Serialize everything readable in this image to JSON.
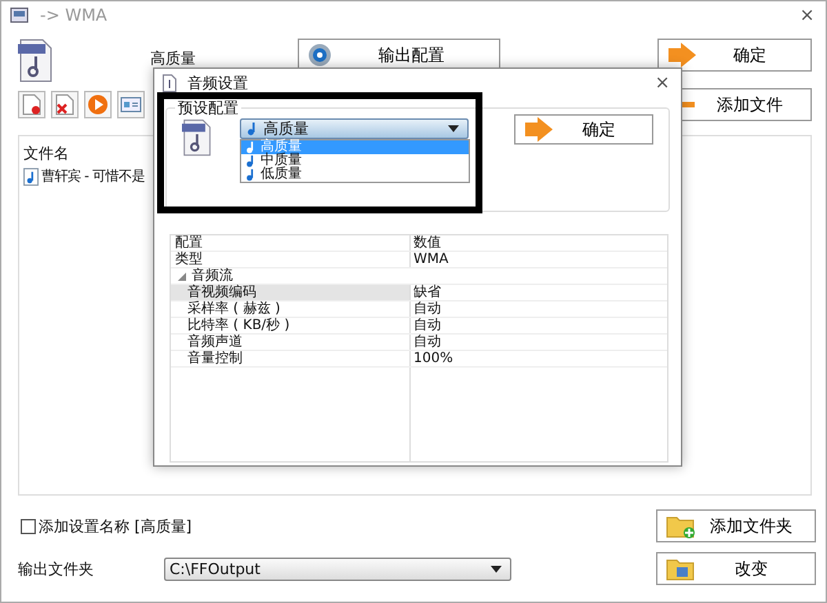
{
  "window": {
    "title": "-> WMA",
    "close": "×"
  },
  "preset_label": "高质量",
  "buttons": {
    "output_config": "输出配置",
    "ok": "确定",
    "add_file": "添加文件",
    "add_folder": "添加文件夹",
    "change": "改变"
  },
  "file_list": {
    "column": "文件名",
    "rows": [
      {
        "name": "曹轩宾 - 可惜不是",
        "selected": false
      }
    ]
  },
  "add_setting_name": {
    "label": "添加设置名称 [高质量]",
    "checked": false
  },
  "output_folder": {
    "label": "输出文件夹",
    "value": "C:\\FFOutput"
  },
  "dialog": {
    "title": "音频设置",
    "close": "×",
    "group": "预设配置",
    "combo": {
      "value": "高质量",
      "expanded": true,
      "options": [
        {
          "label": "高质量",
          "selected": true
        },
        {
          "label": "中质量",
          "selected": false
        },
        {
          "label": "低质量",
          "selected": false
        }
      ]
    },
    "ok": "确定",
    "grid": {
      "columns": [
        "配置",
        "数值"
      ],
      "rows": [
        {
          "name": "类型",
          "value": "WMA",
          "selected": false
        },
        {
          "name": "音频流",
          "expanded": true,
          "selected": false,
          "children": [
            {
              "name": "音视频编码",
              "value": "缺省",
              "selected": true
            },
            {
              "name": "采样率 ( 赫兹 )",
              "value": "自动",
              "selected": false
            },
            {
              "name": "比特率 ( KB/秒 )",
              "value": "自动",
              "selected": false
            },
            {
              "name": "音频声道",
              "value": "自动",
              "selected": false
            },
            {
              "name": "音量控制",
              "value": "100%",
              "selected": false
            }
          ]
        }
      ]
    }
  }
}
